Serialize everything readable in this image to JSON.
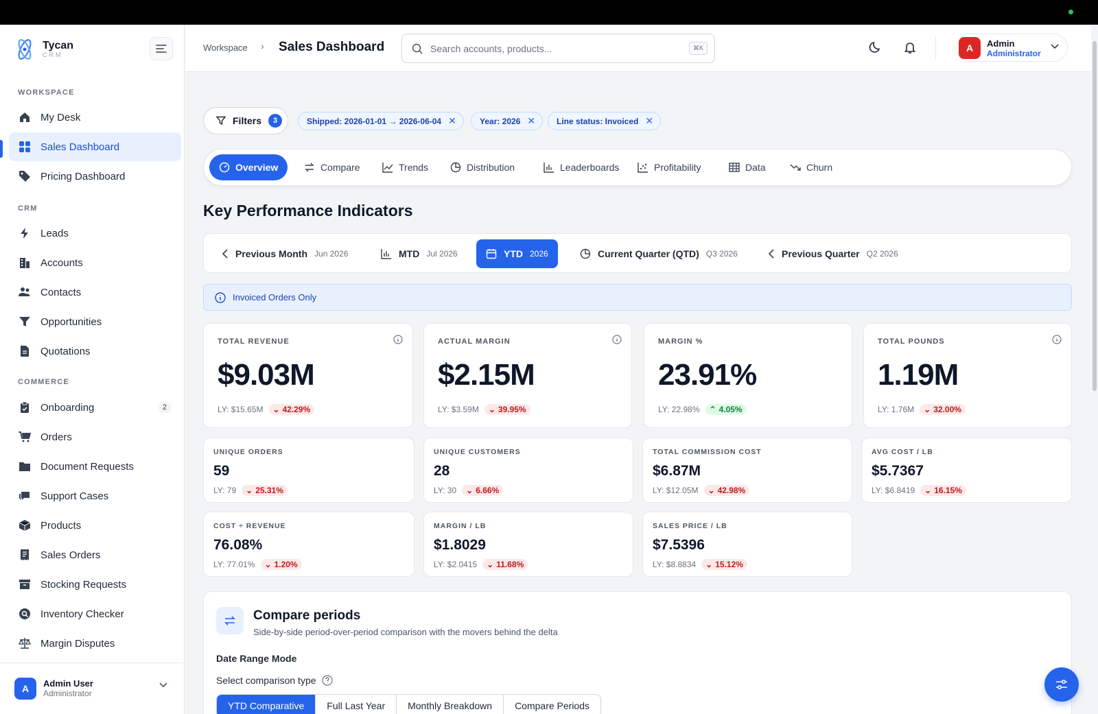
{
  "brand": {
    "name": "Tycan",
    "sub": "CRM"
  },
  "sidebar": {
    "sections": [
      "WORKSPACE",
      "CRM",
      "COMMERCE"
    ],
    "workspace": [
      {
        "label": "My Desk",
        "icon": "home-icon"
      },
      {
        "label": "Sales Dashboard",
        "icon": "grid-icon",
        "active": true
      },
      {
        "label": "Pricing Dashboard",
        "icon": "tag-icon"
      }
    ],
    "crm": [
      {
        "label": "Leads",
        "icon": "bolt-icon"
      },
      {
        "label": "Accounts",
        "icon": "building-icon"
      },
      {
        "label": "Contacts",
        "icon": "users-icon"
      },
      {
        "label": "Opportunities",
        "icon": "funnel-icon"
      },
      {
        "label": "Quotations",
        "icon": "document-icon"
      }
    ],
    "commerce": [
      {
        "label": "Onboarding",
        "icon": "clipboard-icon",
        "badge": "2"
      },
      {
        "label": "Orders",
        "icon": "cart-icon"
      },
      {
        "label": "Document Requests",
        "icon": "folder-icon"
      },
      {
        "label": "Support Cases",
        "icon": "chat-icon"
      },
      {
        "label": "Products",
        "icon": "box-icon"
      },
      {
        "label": "Sales Orders",
        "icon": "receipt-icon"
      },
      {
        "label": "Stocking Requests",
        "icon": "archive-icon"
      },
      {
        "label": "Inventory Checker",
        "icon": "magnifier-icon"
      },
      {
        "label": "Margin Disputes",
        "icon": "scale-icon"
      }
    ],
    "footer": {
      "avatar": "A",
      "name": "Admin User",
      "role": "Administrator"
    }
  },
  "header": {
    "breadcrumb": "Workspace",
    "title": "Sales Dashboard",
    "search_placeholder": "Search accounts, products...",
    "search_kbd": "⌘K",
    "user": {
      "avatar": "A",
      "name": "Admin",
      "role": "Administrator"
    }
  },
  "filters": {
    "label": "Filters",
    "count": "3",
    "chips": [
      "Shipped: 2026-01-01 → 2026-06-04",
      "Year: 2026",
      "Line status: Invoiced"
    ]
  },
  "tabs": [
    {
      "label": "Overview",
      "icon": "gauge-icon",
      "active": true
    },
    {
      "label": "Compare",
      "icon": "swap-icon"
    },
    {
      "label": "Trends",
      "icon": "line-chart-icon"
    },
    {
      "label": "Distribution",
      "icon": "pie-icon"
    },
    {
      "label": "Leaderboards",
      "icon": "bar-chart-icon"
    },
    {
      "label": "Profitability",
      "icon": "scatter-icon"
    },
    {
      "label": "Data",
      "icon": "table-icon"
    },
    {
      "label": "Churn",
      "icon": "trend-down-icon"
    }
  ],
  "kpi": {
    "title": "Key Performance Indicators",
    "periods": [
      {
        "label": "Previous Month",
        "sub": "Jun 2026",
        "icon": "chevron-left-icon"
      },
      {
        "label": "MTD",
        "sub": "Jul 2026",
        "icon": "bar-chart-icon"
      },
      {
        "label": "YTD",
        "sub": "2026",
        "icon": "calendar-icon",
        "active": true
      },
      {
        "label": "Current Quarter (QTD)",
        "sub": "Q3 2026",
        "icon": "pie-icon"
      },
      {
        "label": "Previous Quarter",
        "sub": "Q2 2026",
        "icon": "chevron-left-icon"
      }
    ],
    "banner": "Invoiced Orders Only",
    "primary": [
      {
        "label": "TOTAL REVENUE",
        "value": "$9.03M",
        "ly": "LY: $15.65M",
        "delta": "42.29%",
        "dir": "down",
        "info": true
      },
      {
        "label": "ACTUAL MARGIN",
        "value": "$2.15M",
        "ly": "LY: $3.59M",
        "delta": "39.95%",
        "dir": "down",
        "info": true
      },
      {
        "label": "MARGIN %",
        "value": "23.91%",
        "ly": "LY: 22.98%",
        "delta": "4.05%",
        "dir": "up",
        "info": false
      },
      {
        "label": "TOTAL POUNDS",
        "value": "1.19M",
        "ly": "LY: 1.76M",
        "delta": "32.00%",
        "dir": "down",
        "info": true
      }
    ],
    "secondary": [
      {
        "label": "UNIQUE ORDERS",
        "value": "59",
        "ly": "LY: 79",
        "delta": "25.31%",
        "dir": "down"
      },
      {
        "label": "UNIQUE CUSTOMERS",
        "value": "28",
        "ly": "LY: 30",
        "delta": "6.66%",
        "dir": "down"
      },
      {
        "label": "TOTAL COMMISSION COST",
        "value": "$6.87M",
        "ly": "LY: $12.05M",
        "delta": "42.98%",
        "dir": "down"
      },
      {
        "label": "AVG COST / LB",
        "value": "$5.7367",
        "ly": "LY: $6.8419",
        "delta": "16.15%",
        "dir": "down"
      },
      {
        "label": "COST ÷ REVENUE",
        "value": "76.08%",
        "ly": "LY: 77.01%",
        "delta": "1.20%",
        "dir": "down"
      },
      {
        "label": "MARGIN / LB",
        "value": "$1.8029",
        "ly": "LY: $2.0415",
        "delta": "11.68%",
        "dir": "down"
      },
      {
        "label": "SALES PRICE / LB",
        "value": "$7.5396",
        "ly": "LY: $8.8834",
        "delta": "15.12%",
        "dir": "down"
      }
    ]
  },
  "compare": {
    "title": "Compare periods",
    "subtitle": "Side-by-side period-over-period comparison with the movers behind the delta",
    "mode_label": "Date Range Mode",
    "type_label": "Select comparison type",
    "options": [
      "YTD Comparative",
      "Full Last Year",
      "Monthly Breakdown",
      "Compare Periods"
    ],
    "selected": "YTD Comparative"
  },
  "colors": {
    "accent": "#2563eb",
    "down": "#b91c1c",
    "up": "#15803d"
  }
}
